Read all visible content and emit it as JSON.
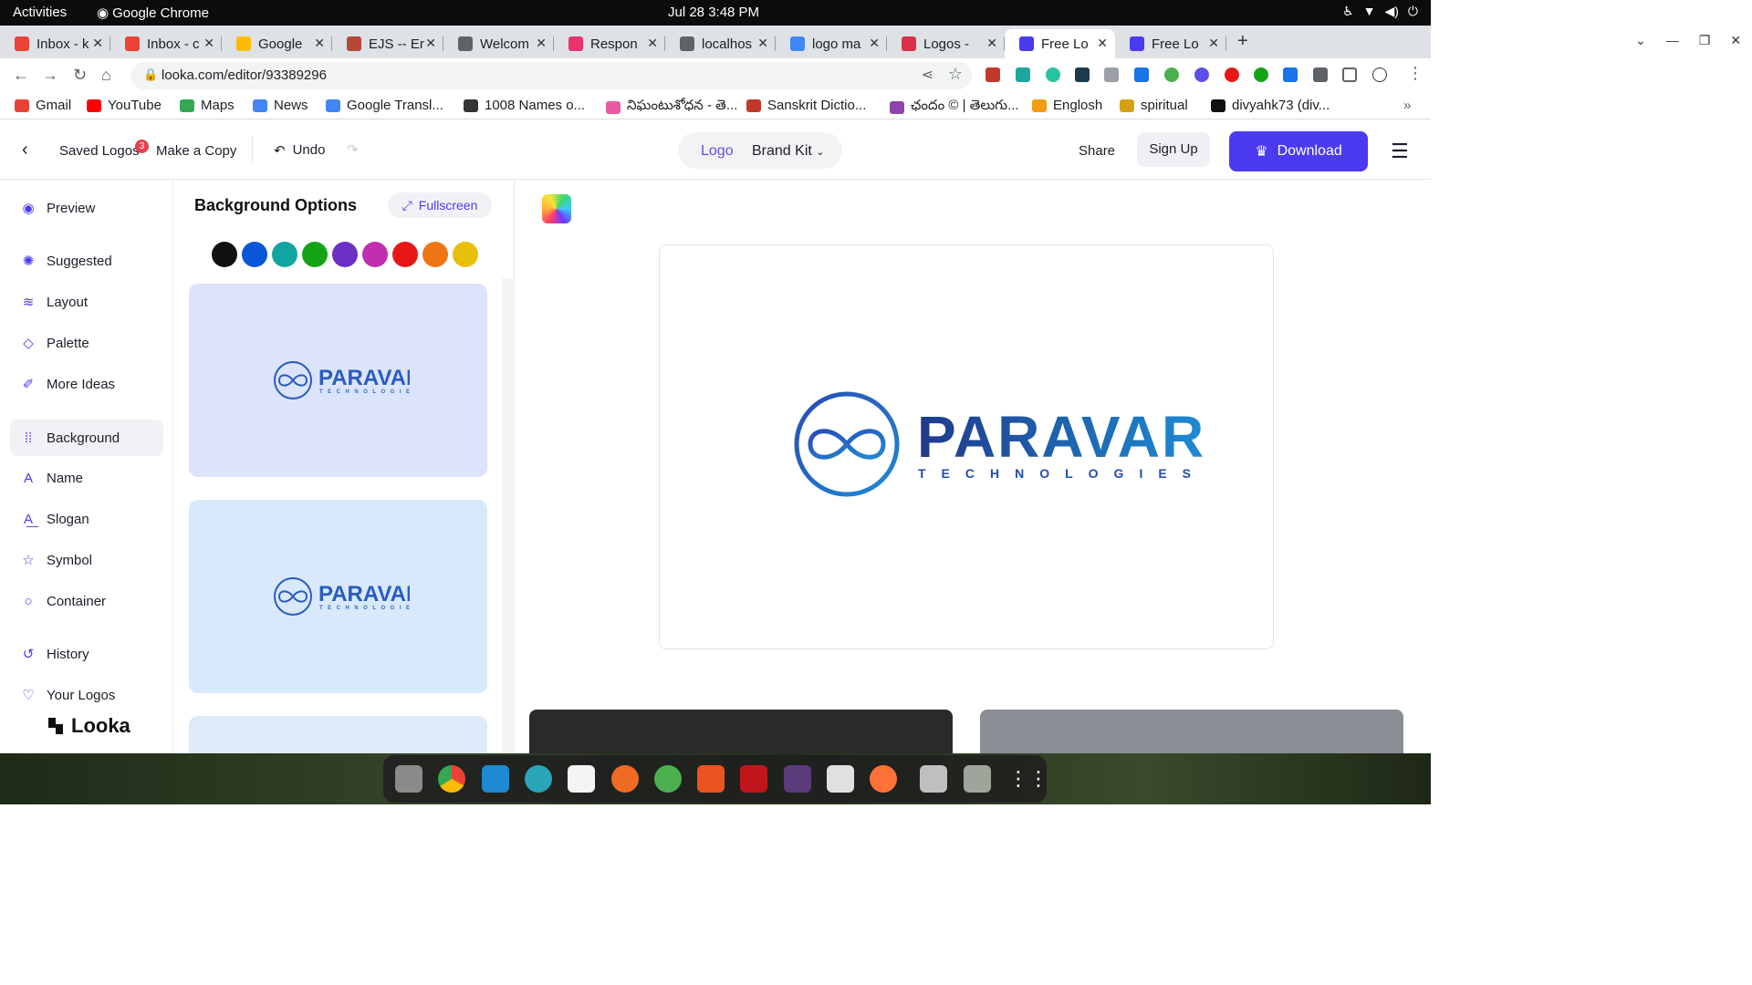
{
  "system": {
    "activities": "Activities",
    "app_name": "Google Chrome",
    "clock": "Jul 28  3:48 PM"
  },
  "tabs": [
    {
      "label": "Inbox - k",
      "favicon": "gmail-icon",
      "color": "#ea4335"
    },
    {
      "label": "Inbox - c",
      "favicon": "gmail-icon",
      "color": "#ea4335"
    },
    {
      "label": "Google",
      "favicon": "keep-icon",
      "color": "#fbbc04"
    },
    {
      "label": "EJS -- Er",
      "favicon": "ejs-icon",
      "color": "#b4493a"
    },
    {
      "label": "Welcom",
      "favicon": "globe-icon",
      "color": "#5f6368"
    },
    {
      "label": "Respon",
      "favicon": "respond-icon",
      "color": "#e8336b"
    },
    {
      "label": "localhos",
      "favicon": "globe-icon",
      "color": "#5f6368"
    },
    {
      "label": "logo ma",
      "favicon": "google-icon",
      "color": "#4285f4"
    },
    {
      "label": "Logos -",
      "favicon": "logos-icon",
      "color": "#d9304a"
    },
    {
      "label": "Free Lo",
      "favicon": "looka-icon",
      "color": "#4a3af0",
      "active": true
    },
    {
      "label": "Free Lo",
      "favicon": "looka-icon",
      "color": "#4a3af0"
    }
  ],
  "address": {
    "url": "looka.com/editor/93389296"
  },
  "bookmarks": [
    {
      "label": "Gmail",
      "icon": "gmail-icon",
      "color": "#ea4335"
    },
    {
      "label": "YouTube",
      "icon": "youtube-icon",
      "color": "#ff0000"
    },
    {
      "label": "Maps",
      "icon": "maps-icon",
      "color": "#34a853"
    },
    {
      "label": "News",
      "icon": "news-icon",
      "color": "#4285f4"
    },
    {
      "label": "Google Transl...",
      "icon": "translate-icon",
      "color": "#4285f4"
    },
    {
      "label": "1008 Names o...",
      "icon": "om-icon",
      "color": "#333333"
    },
    {
      "label": "నిఘంటుశోధన - తె...",
      "icon": "dictionary-icon",
      "color": "#e85aa0"
    },
    {
      "label": "Sanskrit Dictio...",
      "icon": "sanskrit-icon",
      "color": "#c0392b"
    },
    {
      "label": "ఛందం © | తెలుగు...",
      "icon": "chandam-icon",
      "color": "#8e44ad"
    },
    {
      "label": "Englosh",
      "icon": "english-icon",
      "color": "#f39c12"
    },
    {
      "label": "spiritual",
      "icon": "spiritual-icon",
      "color": "#d4a017"
    },
    {
      "label": "divyahk73 (div...",
      "icon": "github-icon",
      "color": "#111111"
    }
  ],
  "header": {
    "saved_logos": "Saved Logos",
    "saved_count": "3",
    "make_copy": "Make a Copy",
    "undo": "Undo",
    "switch_logo": "Logo",
    "switch_brand": "Brand Kit",
    "share": "Share",
    "sign_up": "Sign Up",
    "download": "Download",
    "accent": "#4a3af0"
  },
  "nav": [
    {
      "label": "Preview",
      "icon": "eye-icon"
    },
    {
      "label": "Suggested",
      "icon": "bulb-icon"
    },
    {
      "label": "Layout",
      "icon": "layers-icon"
    },
    {
      "label": "Palette",
      "icon": "drop-icon"
    },
    {
      "label": "More Ideas",
      "icon": "wand-icon"
    },
    {
      "label": "Background",
      "icon": "grid-icon",
      "active": true
    },
    {
      "label": "Name",
      "icon": "text-icon"
    },
    {
      "label": "Slogan",
      "icon": "slogan-icon"
    },
    {
      "label": "Symbol",
      "icon": "star-icon"
    },
    {
      "label": "Container",
      "icon": "circle-icon"
    },
    {
      "label": "History",
      "icon": "history-icon"
    },
    {
      "label": "Your Logos",
      "icon": "heart-icon"
    }
  ],
  "brand_name": "Looka",
  "panel": {
    "title": "Background Options",
    "fullscreen": "Fullscreen",
    "swatches": [
      "#111111",
      "#0a56d8",
      "#10a5a0",
      "#15a315",
      "#6b2fc4",
      "#c02fb0",
      "#e81717",
      "#f07514",
      "#e8c00a"
    ],
    "cards": [
      {
        "background": "#dbe4fb"
      },
      {
        "background": "#d8e9fb"
      },
      {
        "background": "#dcebf7"
      }
    ]
  },
  "logo": {
    "name": "PARAVAR",
    "tagline": "TECHNOLOGIES",
    "color_dark": "#1f3a8a",
    "color_light": "#1e8bd4"
  }
}
